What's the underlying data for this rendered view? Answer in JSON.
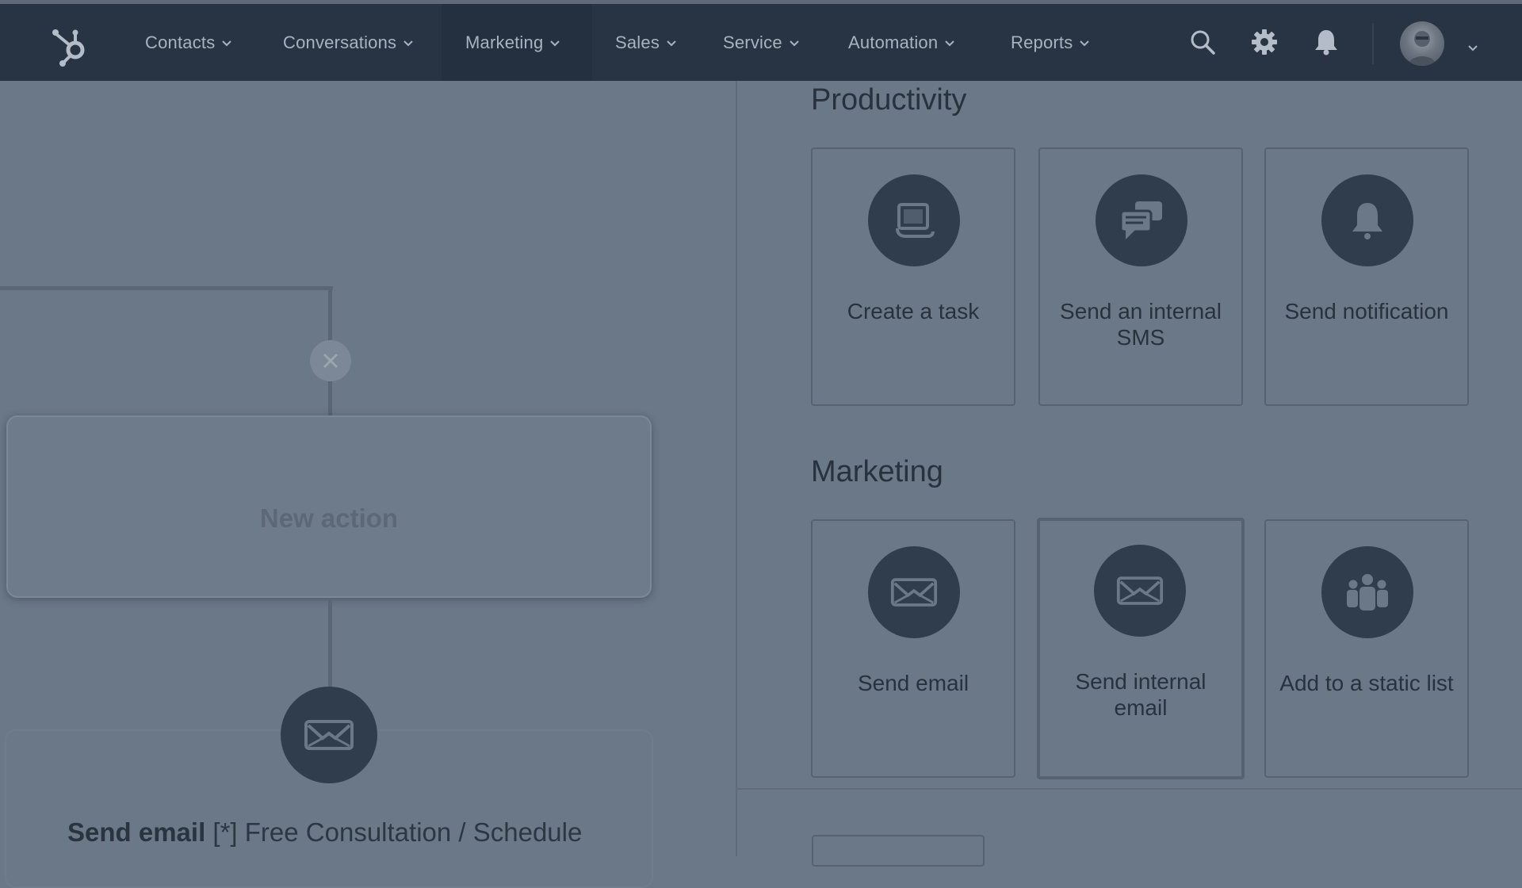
{
  "nav": {
    "items": [
      {
        "label": "Contacts"
      },
      {
        "label": "Conversations"
      },
      {
        "label": "Marketing"
      },
      {
        "label": "Sales"
      },
      {
        "label": "Service"
      },
      {
        "label": "Automation"
      },
      {
        "label": "Reports"
      }
    ],
    "icons": [
      "sprocket-logo-icon",
      "search-icon",
      "gear-icon",
      "bell-icon",
      "avatar",
      "chevron-down-icon"
    ]
  },
  "canvas": {
    "new_action_label": "New action",
    "email_action": {
      "prefix": "Send email",
      "name": "[*] Free Consultation / Schedule"
    }
  },
  "panel": {
    "productivity": {
      "title": "Productivity",
      "tiles": [
        {
          "label": "Create a task",
          "icon": "task-icon"
        },
        {
          "label": "Send an internal SMS",
          "icon": "chat-icon"
        },
        {
          "label": "Send notification",
          "icon": "bell-icon"
        }
      ]
    },
    "marketing": {
      "title": "Marketing",
      "tiles": [
        {
          "label": "Send email",
          "icon": "envelope-icon"
        },
        {
          "label": "Send internal email",
          "icon": "envelope-icon"
        },
        {
          "label": "Add to a static list",
          "icon": "people-icon"
        }
      ]
    }
  },
  "colors": {
    "nav_bg": "#283443",
    "overlay_bg": "#6b7888",
    "icon_circle": "#2f3d4c",
    "text_dark": "#27323e"
  }
}
